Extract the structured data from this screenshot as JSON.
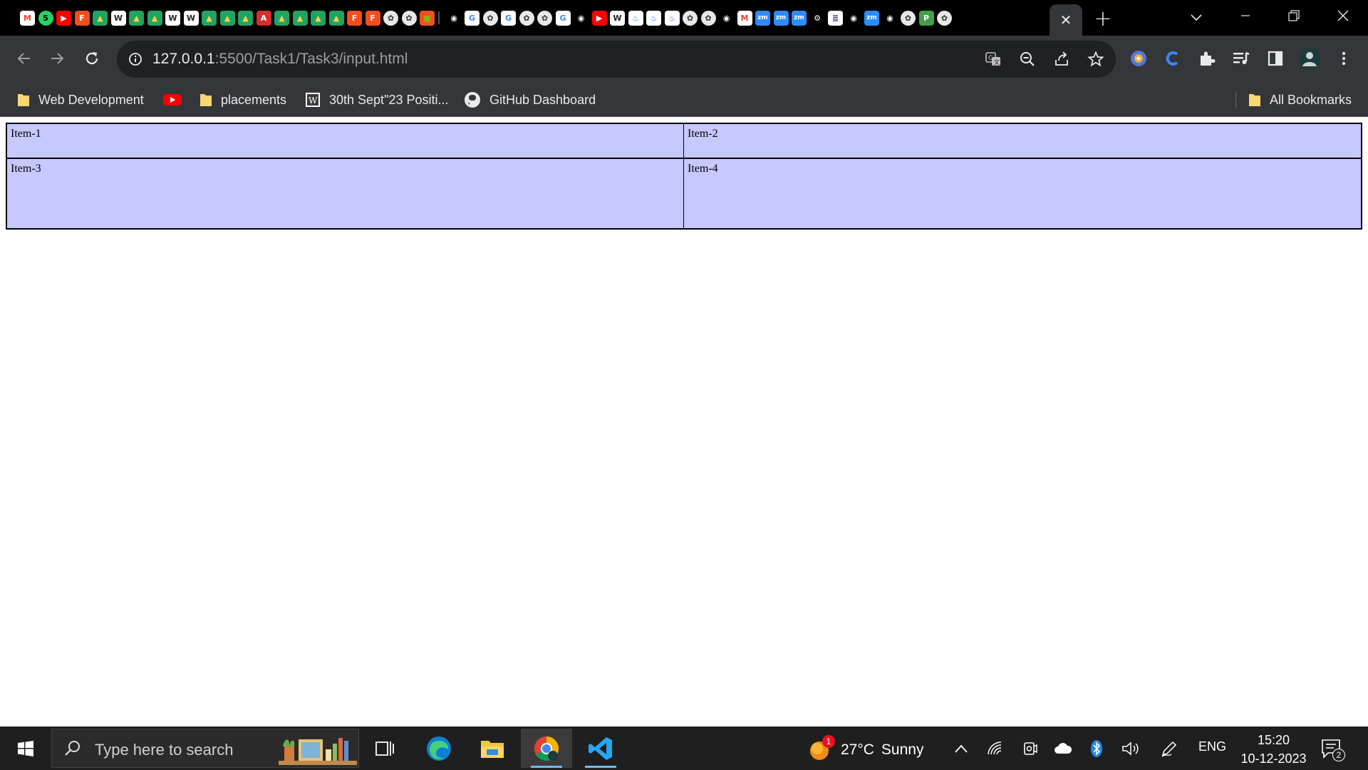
{
  "browser": {
    "active_tab_close": "✕",
    "new_tab": "+",
    "tab_favicons": [
      "gmail-icon",
      "whatsapp-icon",
      "youtube-icon",
      "figma-icon",
      "google-drive-icon",
      "wordpress-icon",
      "google-drive-icon",
      "google-drive-icon",
      "wordpress-icon",
      "wordpress-icon",
      "google-drive-icon",
      "google-drive-icon",
      "google-drive-icon",
      "acrobat-icon",
      "google-drive-icon",
      "google-drive-icon",
      "google-drive-icon",
      "google-drive-icon",
      "figma-icon",
      "figma-icon",
      "chatgpt-icon",
      "chatgpt-icon",
      "microsoft-icon",
      "github-icon",
      "google-icon",
      "chatgpt-icon",
      "google-icon",
      "chatgpt-icon",
      "chatgpt-icon",
      "google-icon",
      "github-icon",
      "youtube-icon",
      "wordpress-icon",
      "flame-icon",
      "flame-icon",
      "flame-icon",
      "chatgpt-icon",
      "chatgpt-icon",
      "github-icon",
      "gmail-icon",
      "zoom-icon",
      "zoom-icon",
      "zoom-icon",
      "gear-icon",
      "list-icon",
      "github-icon",
      "zoom-icon",
      "github-icon",
      "chatgpt-icon",
      "pdf-icon",
      "chatgpt-icon"
    ]
  },
  "toolbar": {
    "url_host": "127.0.0.1",
    "url_rest": ":5500/Task1/Task3/input.html"
  },
  "bookmarks": {
    "items": [
      {
        "label": "Web Development",
        "icon": "folder-icon"
      },
      {
        "label": "",
        "icon": "youtube-icon"
      },
      {
        "label": "placements",
        "icon": "folder-icon"
      },
      {
        "label": "30th Sept\"23 Positi...",
        "icon": "wordpress-icon"
      },
      {
        "label": "GitHub Dashboard",
        "icon": "github-icon"
      }
    ],
    "all_bookmarks": "All Bookmarks"
  },
  "content": {
    "items": [
      "Item-1",
      "Item-2",
      "Item-3",
      "Item-4"
    ],
    "cell_bg": "#c6c8ff"
  },
  "taskbar": {
    "search_placeholder": "Type here to search",
    "weather": {
      "temp": "27°C",
      "condition": "Sunny",
      "badge": "1"
    },
    "language": "ENG",
    "time": "15:20",
    "date": "10-12-2023",
    "notification_count": "2"
  }
}
